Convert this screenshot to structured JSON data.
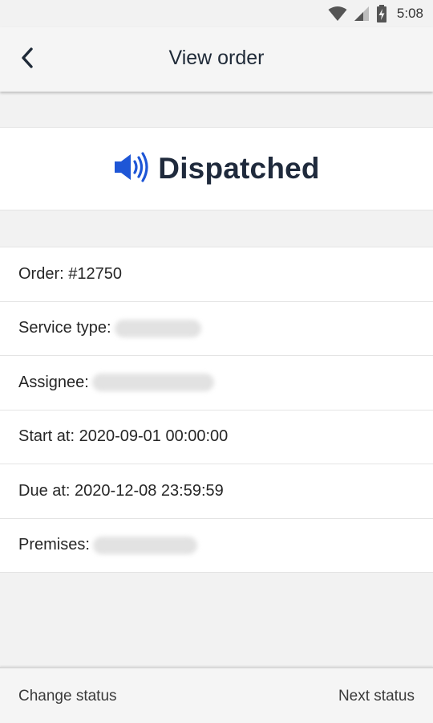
{
  "status_bar": {
    "time": "5:08",
    "icons": [
      "wifi-icon",
      "cell-signal-icon",
      "battery-charging-icon"
    ]
  },
  "app_bar": {
    "title": "View order",
    "back_icon": "chevron-left-icon"
  },
  "order_status": {
    "icon": "megaphone-icon",
    "label": "Dispatched",
    "accent_color": "#1e56d6"
  },
  "details": {
    "order": "Order: #12750",
    "service_type": "Service type:",
    "assignee": "Assignee:",
    "start_at": "Start at: 2020-09-01 00:00:00",
    "due_at": "Due at: 2020-12-08 23:59:59",
    "premises": "Premises:"
  },
  "bottom_bar": {
    "left_label": "Change status",
    "right_label": "Next status"
  }
}
